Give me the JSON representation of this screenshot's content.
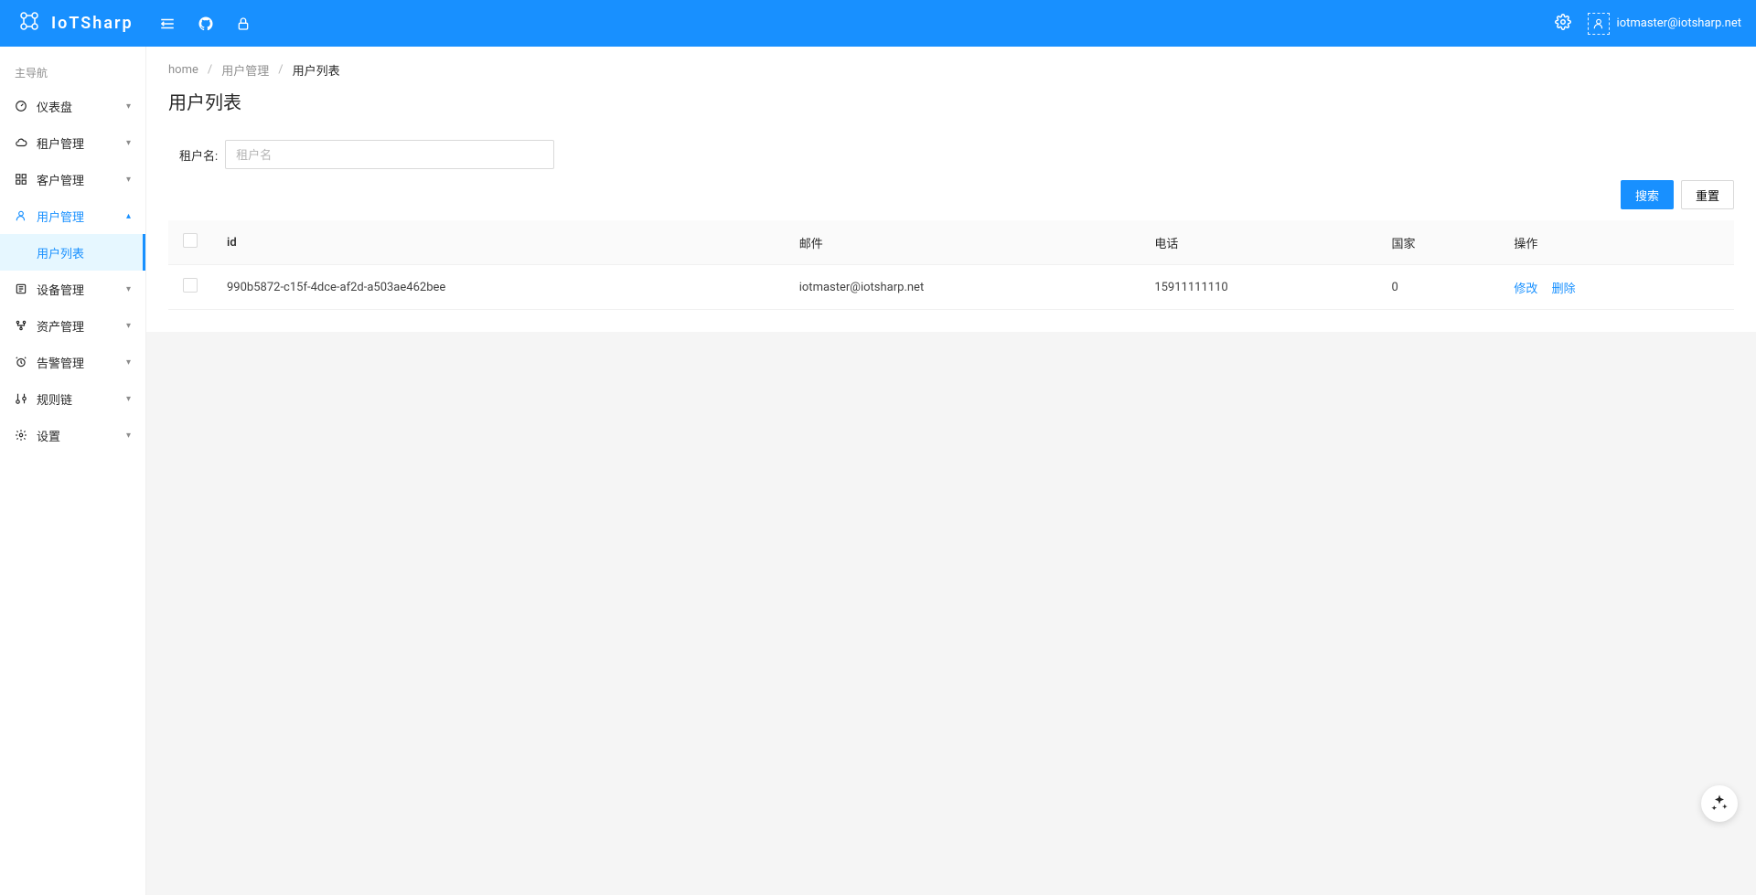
{
  "header": {
    "brand": "IoTSharp",
    "user_email": "iotmaster@iotsharp.net"
  },
  "sidebar": {
    "group_title": "主导航",
    "items": [
      {
        "label": "仪表盘",
        "icon": "dashboard"
      },
      {
        "label": "租户管理",
        "icon": "cloud"
      },
      {
        "label": "客户管理",
        "icon": "apps"
      },
      {
        "label": "用户管理",
        "icon": "user",
        "expanded": true,
        "sub": [
          {
            "label": "用户列表",
            "active": true
          }
        ]
      },
      {
        "label": "设备管理",
        "icon": "device"
      },
      {
        "label": "资产管理",
        "icon": "asset"
      },
      {
        "label": "告警管理",
        "icon": "alarm"
      },
      {
        "label": "规则链",
        "icon": "rule"
      },
      {
        "label": "设置",
        "icon": "setting"
      }
    ]
  },
  "breadcrumb": {
    "items": [
      "home",
      "用户管理",
      "用户列表"
    ]
  },
  "page": {
    "title": "用户列表"
  },
  "search": {
    "label": "租户名:",
    "placeholder": "租户名"
  },
  "buttons": {
    "search": "搜索",
    "reset": "重置"
  },
  "table": {
    "columns": [
      "id",
      "邮件",
      "电话",
      "国家",
      "操作"
    ],
    "rows": [
      {
        "id": "990b5872-c15f-4dce-af2d-a503ae462bee",
        "email": "iotmaster@iotsharp.net",
        "phone": "15911111110",
        "country": "0",
        "actions": {
          "edit": "修改",
          "delete": "删除"
        }
      }
    ]
  }
}
